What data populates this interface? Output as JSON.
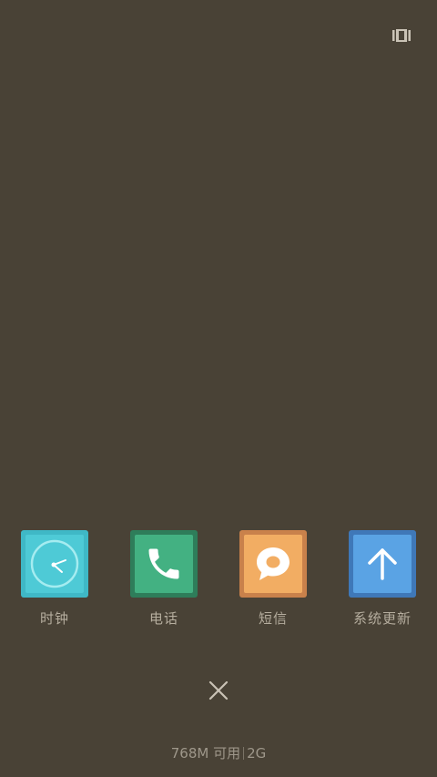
{
  "colors": {
    "background": "#494236",
    "label_text": "#b5ad9e",
    "clock_outer": "#3fb8c6",
    "clock_inner": "#4ecad6",
    "phone_outer": "#2e7d5a",
    "phone_inner": "#43b182",
    "sms_outer": "#c9814b",
    "sms_inner": "#f2ad63",
    "update_outer": "#3f78b8",
    "update_inner": "#5aa3e4"
  },
  "top_toggle": {
    "icon": "recent-apps-toggle-icon"
  },
  "recent_apps": [
    {
      "label": "时钟",
      "icon": "clock-icon"
    },
    {
      "label": "电话",
      "icon": "phone-icon"
    },
    {
      "label": "短信",
      "icon": "message-icon"
    },
    {
      "label": "系统更新",
      "icon": "arrow-up-icon"
    }
  ],
  "close": {
    "icon": "close-icon"
  },
  "memory": {
    "available": "768M 可用",
    "total": "2G"
  }
}
